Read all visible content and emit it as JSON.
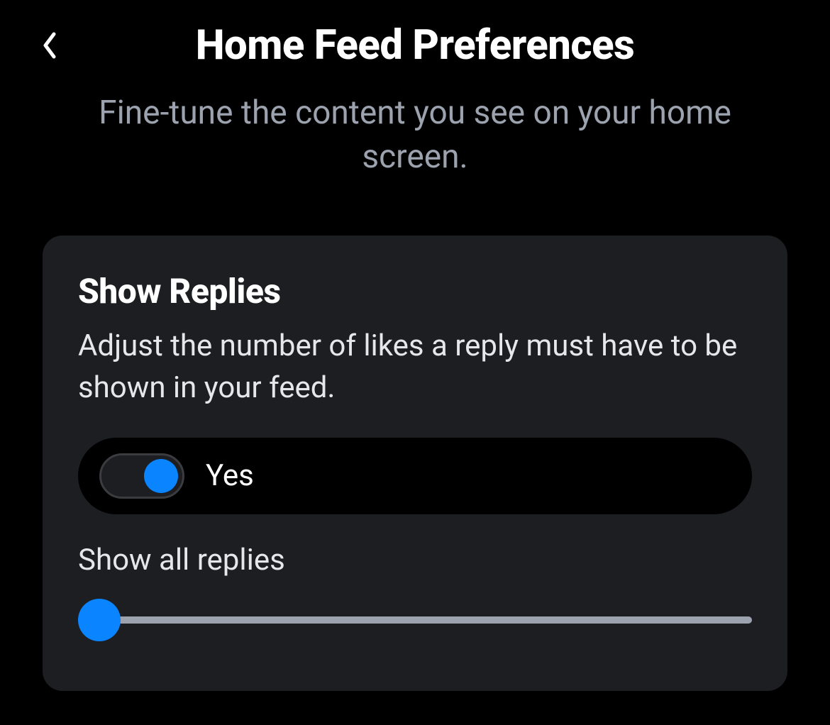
{
  "header": {
    "title": "Home Feed Preferences",
    "subtitle": "Fine-tune the content you see on your home screen."
  },
  "card": {
    "section_title": "Show Replies",
    "section_description": "Adjust the number of likes a reply must have to be shown in your feed.",
    "toggle": {
      "label": "Yes",
      "on": true
    },
    "slider": {
      "label": "Show all replies",
      "value": 0
    }
  },
  "colors": {
    "accent": "#0a84ff",
    "background": "#000000",
    "card_background": "#1c1e21",
    "text_secondary": "#9ca3af"
  }
}
